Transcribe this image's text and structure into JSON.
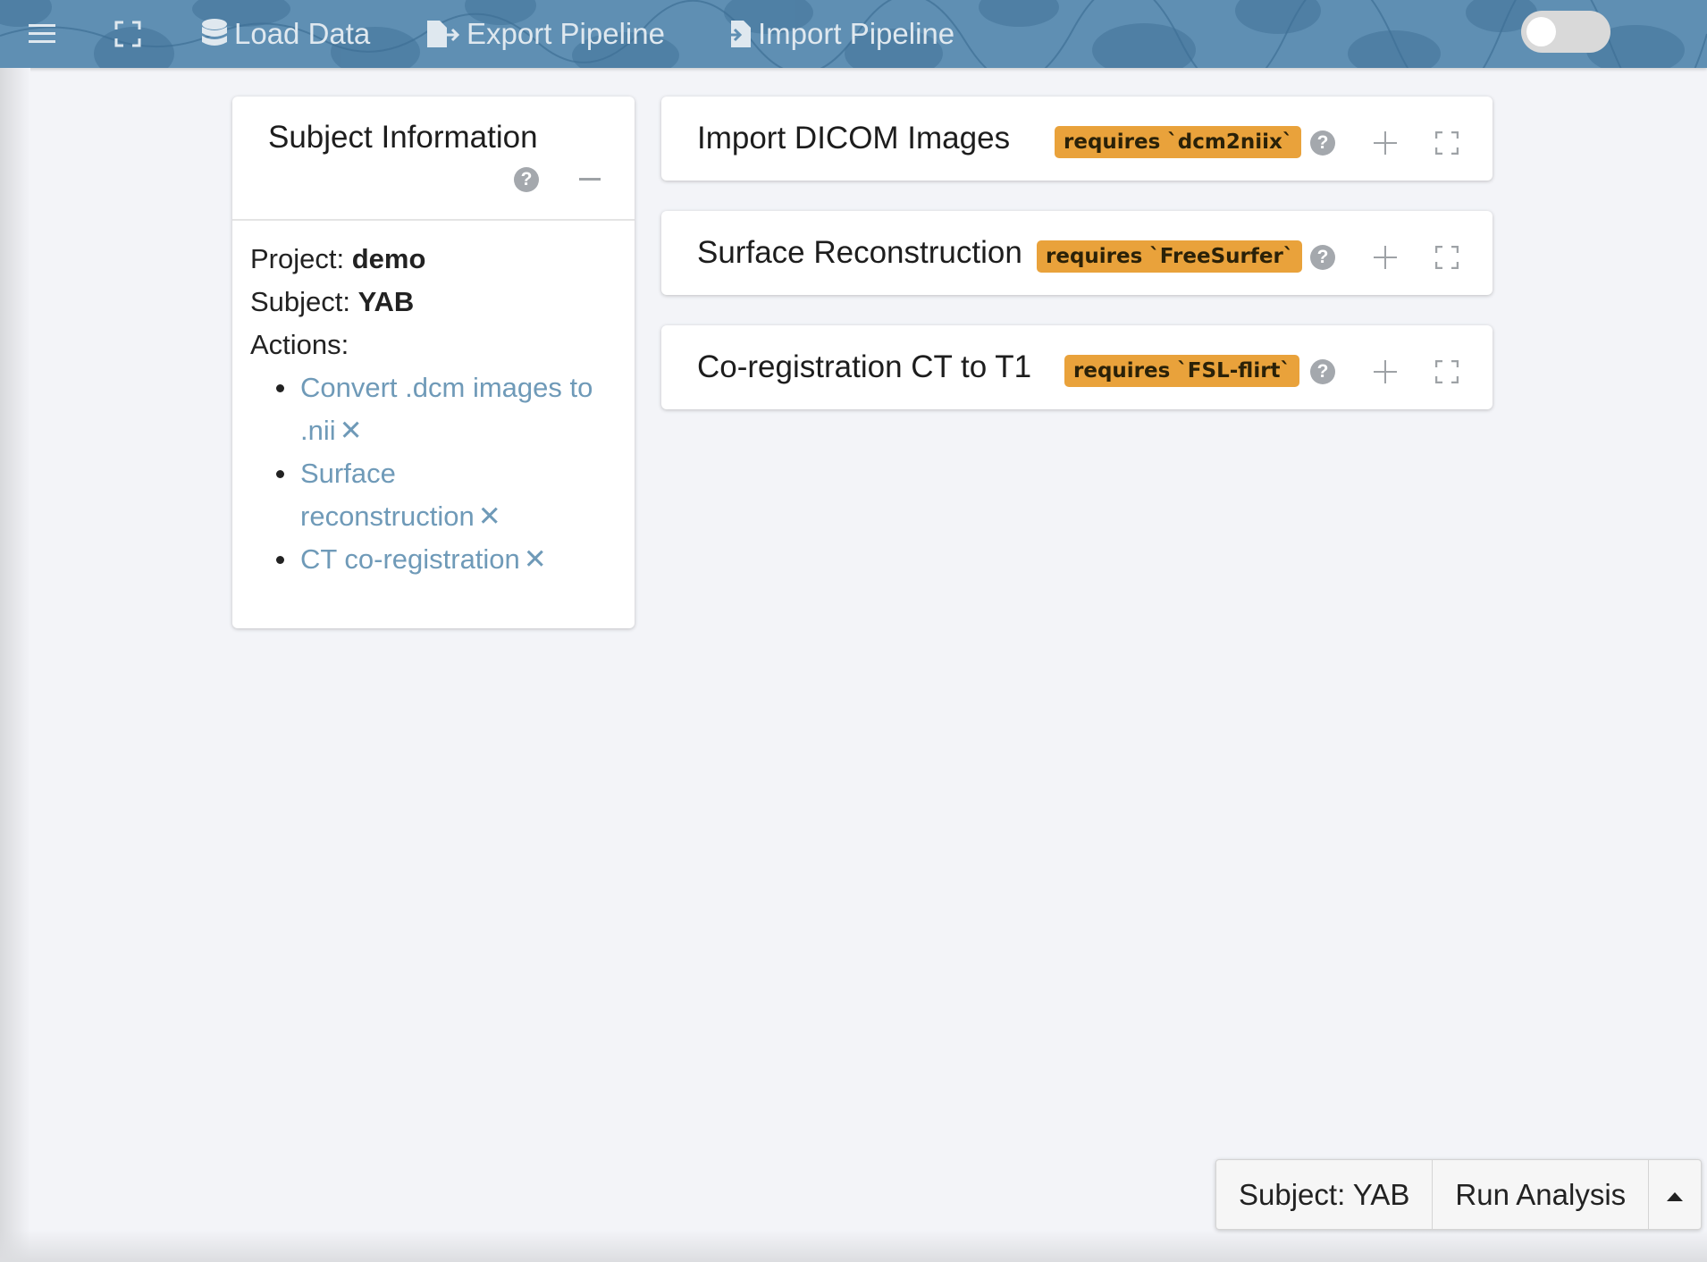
{
  "navbar": {
    "menu_icon": "hamburger-menu-icon",
    "fullscreen_icon": "fullscreen-icon",
    "load_data": "Load Data",
    "export_pipeline": "Export Pipeline",
    "import_pipeline": "Import Pipeline",
    "background_color": "#5f8fb3"
  },
  "subject_card": {
    "title": "Subject Information",
    "project_label": "Project:",
    "project_value": "demo",
    "subject_label": "Subject:",
    "subject_value": "YAB",
    "actions_label": "Actions:",
    "actions": [
      {
        "label": "Convert .dcm images to .nii",
        "remove": "✕"
      },
      {
        "label": "Surface reconstruction",
        "remove": "✕"
      },
      {
        "label": "CT co-registration",
        "remove": "✕"
      }
    ]
  },
  "steps": [
    {
      "title": "Import DICOM Images",
      "badge": "requires `dcm2niix`"
    },
    {
      "title": "Surface Reconstruction",
      "badge": "requires `FreeSurfer`"
    },
    {
      "title": "Co-registration CT to T1",
      "badge": "requires `FSL-flirt`"
    }
  ],
  "footer": {
    "subject_button": "Subject: YAB",
    "run_button": "Run Analysis"
  },
  "colors": {
    "accent_link": "#6f9ab8",
    "badge": "#e9a23b",
    "page_background": "#f3f4f8"
  }
}
